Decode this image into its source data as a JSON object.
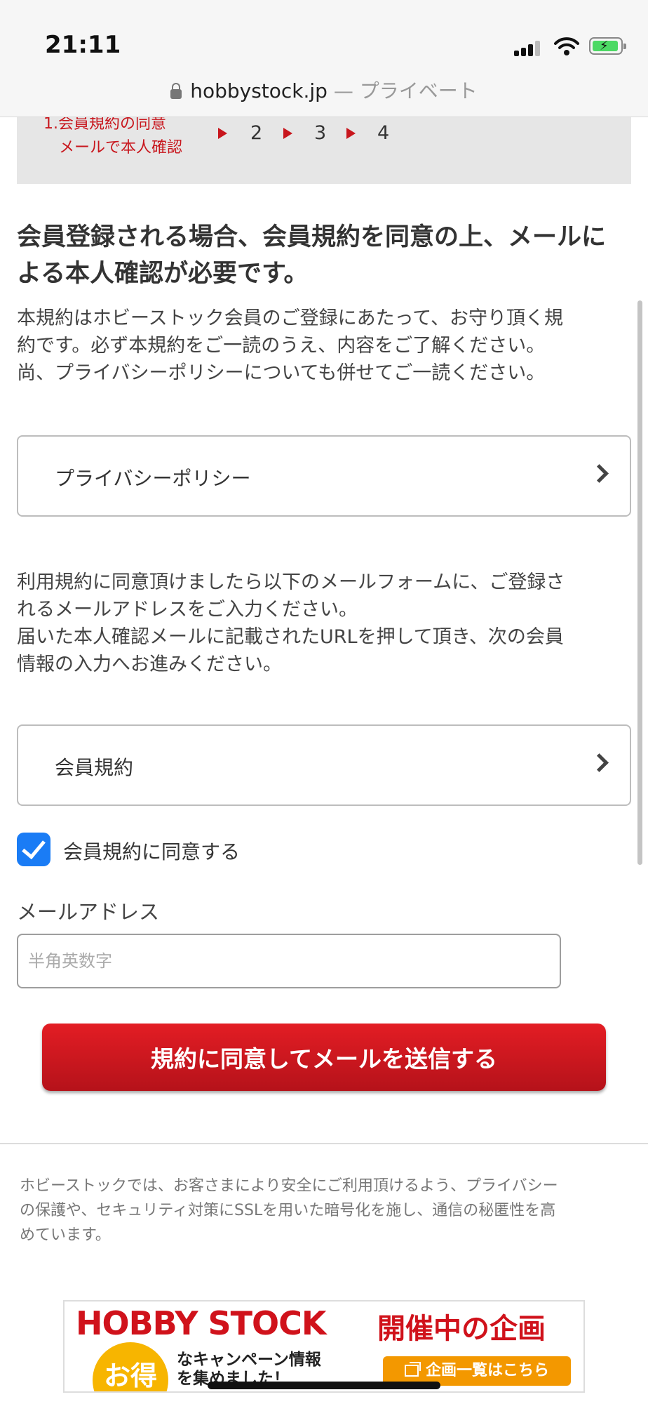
{
  "status_bar": {
    "time": "21:11"
  },
  "browser": {
    "host": "hobbystock.jp",
    "private_label": "— プライベート"
  },
  "steps": {
    "step1_line1": "1.会員規約の同意",
    "step1_line2": "メールで本人確認",
    "step2": "2",
    "step3": "3",
    "step4": "4"
  },
  "heading": "会員登録される場合、会員規約を同意の上、メールによる本人確認が必要です。",
  "intro_lines": [
    "本規約はホビーストック会員のご登録にあたって、お守り頂く規",
    "約です。必ず本規約をご一読のうえ、内容をご了解ください。",
    "尚、プライバシーポリシーについても併せてご一読ください。"
  ],
  "privacy_link": {
    "label": "プライバシーポリシー"
  },
  "instruction_lines": [
    "利用規約に同意頂けましたら以下のメールフォームに、ご登録さ",
    "れるメールアドレスをご入力ください。",
    "届いた本人確認メールに記載されたURLを押して頂き、次の会員",
    "情報の入力へお進みください。"
  ],
  "terms_link": {
    "label": "会員規約"
  },
  "agree_checkbox": {
    "label": "会員規約に同意する",
    "checked": true
  },
  "email": {
    "label": "メールアドレス",
    "placeholder": "半角英数字",
    "value": ""
  },
  "submit": {
    "label": "規約に同意してメールを送信する"
  },
  "footnote_lines": [
    "ホビーストックでは、お客さまにより安全にご利用頂けるよう、プライバシー",
    "の保護や、セキュリティ対策にSSLを用いた暗号化を施し、通信の秘匿性を高",
    "めています。"
  ],
  "banner": {
    "brand": "HOBBY STOCK",
    "event_title": "開催中の企画",
    "badge": "お得",
    "campaign_line1": "なキャンペーン情報",
    "campaign_line2": "を集めました！",
    "cta": "企画一覧はこちら"
  },
  "colors": {
    "accent_red": "#d0121b",
    "checkbox_blue": "#1a7cf5",
    "banner_orange": "#f39800",
    "banner_yellow": "#f7b500",
    "battery_green": "#4cd964"
  },
  "icons": [
    "lock-icon",
    "signal-icon",
    "wifi-icon",
    "battery-icon",
    "step-arrow-icon",
    "chevron-right-icon",
    "checkmark-icon"
  ]
}
